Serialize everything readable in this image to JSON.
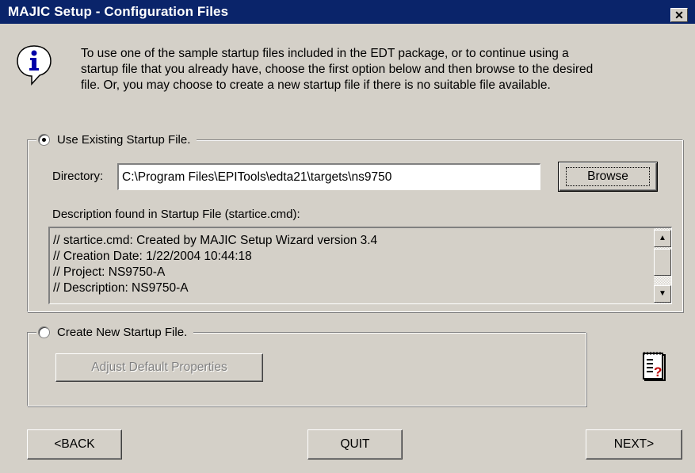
{
  "window": {
    "title": "MAJIC Setup - Configuration Files",
    "close_glyph": "✕"
  },
  "intro": {
    "icon": "info-icon",
    "line1": "To use one of the sample startup files included in the EDT package, or to continue using a",
    "line2": "startup file that you already have, choose the first option below and then browse to the desired",
    "line3": "file.  Or, you may choose to create a new startup file if there is no suitable file available."
  },
  "existing": {
    "option_label": "Use Existing Startup File.",
    "selected": true,
    "directory_label": "Directory:",
    "directory_value": "C:\\Program Files\\EPITools\\edta21\\targets\\ns9750",
    "browse_label": "Browse",
    "description_label": "Description found in Startup File (startice.cmd):",
    "description_lines": [
      "// startice.cmd: Created by MAJIC Setup Wizard version 3.4",
      "// Creation Date: 1/22/2004 10:44:18",
      "// Project: NS9750-A",
      "// Description: NS9750-A"
    ]
  },
  "new_file": {
    "option_label": "Create New Startup File.",
    "selected": false,
    "adjust_label": "Adjust Default Properties",
    "help_icon": "help-document-icon"
  },
  "nav": {
    "back_label": "<BACK",
    "quit_label": "QUIT",
    "next_label": "NEXT>"
  },
  "colors": {
    "titlebar": "#0a246a",
    "face": "#d4d0c8",
    "info_blue": "#0000a8"
  }
}
